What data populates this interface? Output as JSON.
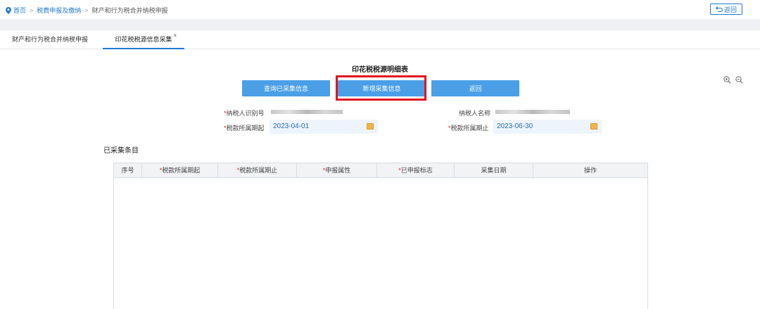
{
  "breadcrumb": {
    "home": "首页",
    "level2": "税费申报及缴纳",
    "current": "财产和行为税合并纳税申报",
    "separator": ">"
  },
  "top_back_button": "返回",
  "tabs": [
    {
      "label": "财产和行为税合并纳税申报"
    },
    {
      "label": "印花税税源信息采集",
      "close": "×"
    }
  ],
  "form": {
    "title": "印花税税源明细表",
    "buttons": {
      "query": "查询已采集信息",
      "add_new": "新增采集信息",
      "back": "返回"
    },
    "fields": {
      "taxpayer_id_label": "纳税人识别号",
      "taxpayer_name_label": "纳税人名称",
      "period_start_label": "税款所属期起",
      "period_start_value": "2023-04-01",
      "period_end_label": "税款所属期止",
      "period_end_value": "2023-06-30",
      "required_mark": "*"
    }
  },
  "collected": {
    "title": "已采集条目",
    "columns": [
      {
        "label": "序号",
        "required": false
      },
      {
        "label": "税款所属期起",
        "required": true
      },
      {
        "label": "税款所属期止",
        "required": true
      },
      {
        "label": "申报属性",
        "required": true
      },
      {
        "label": "已申报标志",
        "required": true
      },
      {
        "label": "采集日期",
        "required": false
      },
      {
        "label": "操作",
        "required": false
      }
    ],
    "rows": []
  },
  "colors": {
    "accent": "#1f78d1",
    "button": "#4a9fe6",
    "highlight": "#e0141e"
  },
  "icons": [
    "location-pin-icon",
    "back-arrow-icon",
    "zoom-in-icon",
    "zoom-out-icon",
    "calendar-icon"
  ]
}
